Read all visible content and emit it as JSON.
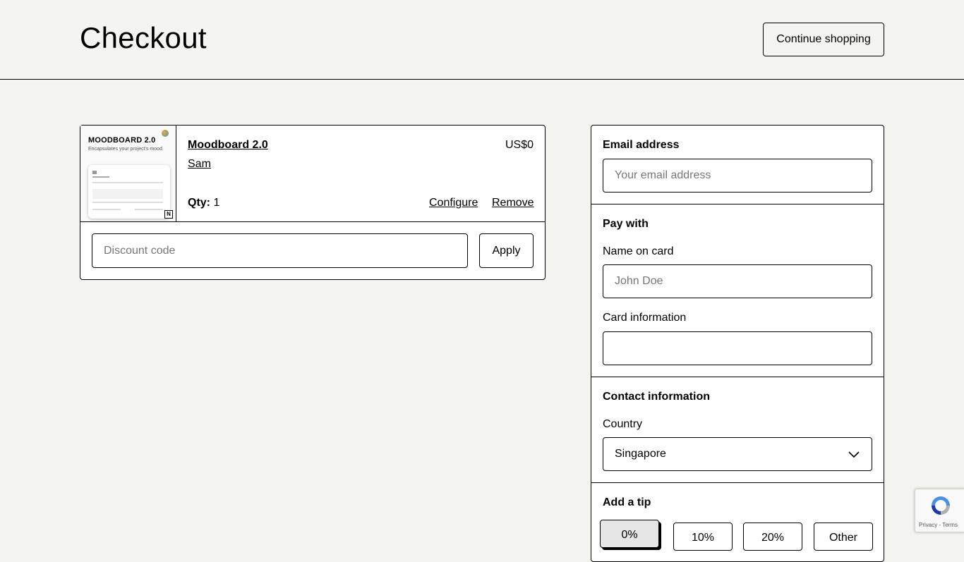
{
  "header": {
    "title": "Checkout",
    "continue_label": "Continue shopping"
  },
  "cart": {
    "item": {
      "name": "Moodboard 2.0",
      "author": "Sam",
      "price": "US$0",
      "qty_label": "Qty:",
      "qty_value": "1",
      "configure_label": "Configure",
      "remove_label": "Remove",
      "thumbnail": {
        "title": "MOODBOARD 2.0",
        "subtitle": "Encapsulates your project's mood."
      }
    },
    "discount": {
      "placeholder": "Discount code",
      "apply_label": "Apply"
    }
  },
  "form": {
    "email": {
      "label": "Email address",
      "placeholder": "Your email address"
    },
    "pay": {
      "heading": "Pay with",
      "name_label": "Name on card",
      "name_placeholder": "John Doe",
      "card_label": "Card information"
    },
    "contact": {
      "heading": "Contact information",
      "country_label": "Country",
      "country_value": "Singapore"
    },
    "tip": {
      "heading": "Add a tip",
      "options": [
        "0%",
        "10%",
        "20%",
        "Other"
      ],
      "selected": "0%"
    }
  },
  "recaptcha": {
    "links": "Privacy - Terms"
  },
  "colors": {
    "background": "#f4f4f0",
    "border": "#000000",
    "selected_tip": "#e6e6e6"
  }
}
